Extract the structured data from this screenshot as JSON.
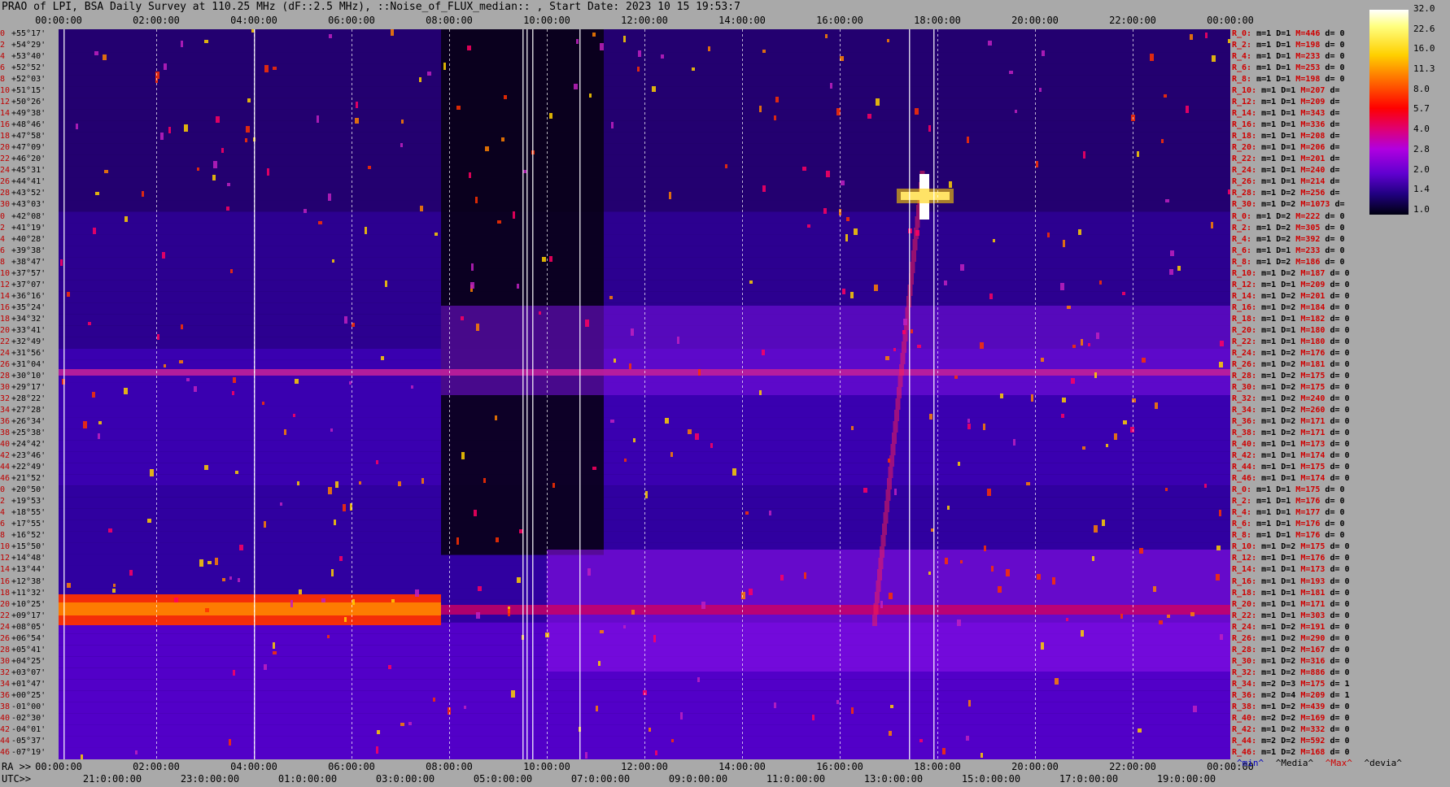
{
  "title": "PRAO of LPI, BSA Daily Survey at 110.25 MHz (dF::2.5 MHz), ::Noise_of_FLUX_median:: , Start Date: 2023 10 15 19:53:7",
  "top_time_labels": [
    "00:00:00",
    "02:00:00",
    "04:00:00",
    "06:00:00",
    "08:00:00",
    "10:00:00",
    "12:00:00",
    "14:00:00",
    "16:00:00",
    "18:00:00",
    "20:00:00",
    "22:00:00",
    "00:00:00"
  ],
  "bottom_ra_prefix": "RA >>",
  "bottom_ra_labels": [
    "00:00:00",
    "02:00:00",
    "04:00:00",
    "06:00:00",
    "08:00:00",
    "10:00:00",
    "12:00:00",
    "14:00:00",
    "16:00:00",
    "18:00:00",
    "20:00:00",
    "22:00:00",
    "00:00:00"
  ],
  "bottom_utc_prefix": "UTC>>",
  "bottom_utc_labels": [
    "21:0:00:00",
    "23:0:00:00",
    "01:0:00:00",
    "03:0:00:00",
    "05:0:00:00",
    "07:0:00:00",
    "09:0:00:00",
    "11:0:00:00",
    "13:0:00:00",
    "15:0:00:00",
    "17:0:00:00",
    "19:0:00:00"
  ],
  "colorbar_labels": [
    "32.0",
    "22.6",
    "16.0",
    "11.3",
    "8.0",
    "5.7",
    "4.0",
    "2.8",
    "2.0",
    "1.4",
    "1.0"
  ],
  "legend": {
    "min": "^min^",
    "median": "^Media^",
    "max": "^Max^",
    "devia": "^devia^"
  },
  "colors": {
    "background": "#a9a9a9",
    "index_red": "#c00000",
    "max_red": "#d00000",
    "plot_base": "#1a0050"
  },
  "row_labels": [
    {
      "i": "0",
      "d": "+55°17'"
    },
    {
      "i": "2",
      "d": "+54°29'"
    },
    {
      "i": "4",
      "d": "+53°40'"
    },
    {
      "i": "6",
      "d": "+52°52'"
    },
    {
      "i": "8",
      "d": "+52°03'"
    },
    {
      "i": "10",
      "d": "+51°15'"
    },
    {
      "i": "12",
      "d": "+50°26'"
    },
    {
      "i": "14",
      "d": "+49°38'"
    },
    {
      "i": "16",
      "d": "+48°46'"
    },
    {
      "i": "18",
      "d": "+47°58'"
    },
    {
      "i": "20",
      "d": "+47°09'"
    },
    {
      "i": "22",
      "d": "+46°20'"
    },
    {
      "i": "24",
      "d": "+45°31'"
    },
    {
      "i": "26",
      "d": "+44°41'"
    },
    {
      "i": "28",
      "d": "+43°52'"
    },
    {
      "i": "30",
      "d": "+43°03'"
    },
    {
      "i": "0",
      "d": "+42°08'"
    },
    {
      "i": "2",
      "d": "+41°19'"
    },
    {
      "i": "4",
      "d": "+40°28'"
    },
    {
      "i": "6",
      "d": "+39°38'"
    },
    {
      "i": "8",
      "d": "+38°47'"
    },
    {
      "i": "10",
      "d": "+37°57'"
    },
    {
      "i": "12",
      "d": "+37°07'"
    },
    {
      "i": "14",
      "d": "+36°16'"
    },
    {
      "i": "16",
      "d": "+35°24'"
    },
    {
      "i": "18",
      "d": "+34°32'"
    },
    {
      "i": "20",
      "d": "+33°41'"
    },
    {
      "i": "22",
      "d": "+32°49'"
    },
    {
      "i": "24",
      "d": "+31°56'"
    },
    {
      "i": "26",
      "d": "+31°04'"
    },
    {
      "i": "28",
      "d": "+30°10'"
    },
    {
      "i": "30",
      "d": "+29°17'"
    },
    {
      "i": "32",
      "d": "+28°22'"
    },
    {
      "i": "34",
      "d": "+27°28'"
    },
    {
      "i": "36",
      "d": "+26°34'"
    },
    {
      "i": "38",
      "d": "+25°38'"
    },
    {
      "i": "40",
      "d": "+24°42'"
    },
    {
      "i": "42",
      "d": "+23°46'"
    },
    {
      "i": "44",
      "d": "+22°49'"
    },
    {
      "i": "46",
      "d": "+21°52'"
    },
    {
      "i": "0",
      "d": "+20°50'"
    },
    {
      "i": "2",
      "d": "+19°53'"
    },
    {
      "i": "4",
      "d": "+18°55'"
    },
    {
      "i": "6",
      "d": "+17°55'"
    },
    {
      "i": "8",
      "d": "+16°52'"
    },
    {
      "i": "10",
      "d": "+15°50'"
    },
    {
      "i": "12",
      "d": "+14°48'"
    },
    {
      "i": "14",
      "d": "+13°44'"
    },
    {
      "i": "16",
      "d": "+12°38'"
    },
    {
      "i": "18",
      "d": "+11°32'"
    },
    {
      "i": "20",
      "d": "+10°25'"
    },
    {
      "i": "22",
      "d": "+09°17'"
    },
    {
      "i": "24",
      "d": "+08°05'"
    },
    {
      "i": "26",
      "d": "+06°54'"
    },
    {
      "i": "28",
      "d": "+05°41'"
    },
    {
      "i": "30",
      "d": "+04°25'"
    },
    {
      "i": "32",
      "d": "+03°07'"
    },
    {
      "i": "34",
      "d": "+01°47'"
    },
    {
      "i": "36",
      "d": "+00°25'"
    },
    {
      "i": "38",
      "d": "-01°00'"
    },
    {
      "i": "40",
      "d": "-02°30'"
    },
    {
      "i": "42",
      "d": "-04°01'"
    },
    {
      "i": "44",
      "d": "-05°37'"
    },
    {
      "i": "46",
      "d": "-07°19'"
    }
  ],
  "right_rows": [
    {
      "r": "R_0:",
      "m": "m=1",
      "D": "D=1",
      "M": "M=446",
      "d": "d= 0"
    },
    {
      "r": "R_2:",
      "m": "m=1",
      "D": "D=1",
      "M": "M=198",
      "d": "d= 0"
    },
    {
      "r": "R_4:",
      "m": "m=1",
      "D": "D=1",
      "M": "M=233",
      "d": "d= 0"
    },
    {
      "r": "R_6:",
      "m": "m=1",
      "D": "D=1",
      "M": "M=253",
      "d": "d= 0"
    },
    {
      "r": "R_8:",
      "m": "m=1",
      "D": "D=1",
      "M": "M=198",
      "d": "d= 0"
    },
    {
      "r": "R_10:",
      "m": "m=1",
      "D": "D=1",
      "M": "M=207",
      "d": "d="
    },
    {
      "r": "R_12:",
      "m": "m=1",
      "D": "D=1",
      "M": "M=209",
      "d": "d="
    },
    {
      "r": "R_14:",
      "m": "m=1",
      "D": "D=1",
      "M": "M=343",
      "d": "d="
    },
    {
      "r": "R_16:",
      "m": "m=1",
      "D": "D=1",
      "M": "M=336",
      "d": "d="
    },
    {
      "r": "R_18:",
      "m": "m=1",
      "D": "D=1",
      "M": "M=208",
      "d": "d="
    },
    {
      "r": "R_20:",
      "m": "m=1",
      "D": "D=1",
      "M": "M=206",
      "d": "d="
    },
    {
      "r": "R_22:",
      "m": "m=1",
      "D": "D=1",
      "M": "M=201",
      "d": "d="
    },
    {
      "r": "R_24:",
      "m": "m=1",
      "D": "D=1",
      "M": "M=240",
      "d": "d="
    },
    {
      "r": "R_26:",
      "m": "m=1",
      "D": "D=1",
      "M": "M=214",
      "d": "d="
    },
    {
      "r": "R_28:",
      "m": "m=1",
      "D": "D=2",
      "M": "M=256",
      "d": "d="
    },
    {
      "r": "R_30:",
      "m": "m=1",
      "D": "D=2",
      "M": "M=1073",
      "d": "d="
    },
    {
      "r": "R_0:",
      "m": "m=1",
      "D": "D=2",
      "M": "M=222",
      "d": "d= 0"
    },
    {
      "r": "R_2:",
      "m": "m=1",
      "D": "D=2",
      "M": "M=305",
      "d": "d= 0"
    },
    {
      "r": "R_4:",
      "m": "m=1",
      "D": "D=2",
      "M": "M=392",
      "d": "d= 0"
    },
    {
      "r": "R_6:",
      "m": "m=1",
      "D": "D=1",
      "M": "M=233",
      "d": "d= 0"
    },
    {
      "r": "R_8:",
      "m": "m=1",
      "D": "D=2",
      "M": "M=186",
      "d": "d= 0"
    },
    {
      "r": "R_10:",
      "m": "m=1",
      "D": "D=2",
      "M": "M=187",
      "d": "d= 0"
    },
    {
      "r": "R_12:",
      "m": "m=1",
      "D": "D=1",
      "M": "M=209",
      "d": "d= 0"
    },
    {
      "r": "R_14:",
      "m": "m=1",
      "D": "D=2",
      "M": "M=201",
      "d": "d= 0"
    },
    {
      "r": "R_16:",
      "m": "m=1",
      "D": "D=2",
      "M": "M=184",
      "d": "d= 0"
    },
    {
      "r": "R_18:",
      "m": "m=1",
      "D": "D=1",
      "M": "M=182",
      "d": "d= 0"
    },
    {
      "r": "R_20:",
      "m": "m=1",
      "D": "D=1",
      "M": "M=180",
      "d": "d= 0"
    },
    {
      "r": "R_22:",
      "m": "m=1",
      "D": "D=1",
      "M": "M=180",
      "d": "d= 0"
    },
    {
      "r": "R_24:",
      "m": "m=1",
      "D": "D=2",
      "M": "M=176",
      "d": "d= 0"
    },
    {
      "r": "R_26:",
      "m": "m=1",
      "D": "D=2",
      "M": "M=181",
      "d": "d= 0"
    },
    {
      "r": "R_28:",
      "m": "m=1",
      "D": "D=2",
      "M": "M=175",
      "d": "d= 0"
    },
    {
      "r": "R_30:",
      "m": "m=1",
      "D": "D=2",
      "M": "M=175",
      "d": "d= 0"
    },
    {
      "r": "R_32:",
      "m": "m=1",
      "D": "D=2",
      "M": "M=240",
      "d": "d= 0"
    },
    {
      "r": "R_34:",
      "m": "m=1",
      "D": "D=2",
      "M": "M=260",
      "d": "d= 0"
    },
    {
      "r": "R_36:",
      "m": "m=1",
      "D": "D=2",
      "M": "M=171",
      "d": "d= 0"
    },
    {
      "r": "R_38:",
      "m": "m=1",
      "D": "D=2",
      "M": "M=171",
      "d": "d= 0"
    },
    {
      "r": "R_40:",
      "m": "m=1",
      "D": "D=1",
      "M": "M=173",
      "d": "d= 0"
    },
    {
      "r": "R_42:",
      "m": "m=1",
      "D": "D=1",
      "M": "M=174",
      "d": "d= 0"
    },
    {
      "r": "R_44:",
      "m": "m=1",
      "D": "D=1",
      "M": "M=175",
      "d": "d= 0"
    },
    {
      "r": "R_46:",
      "m": "m=1",
      "D": "D=1",
      "M": "M=174",
      "d": "d= 0"
    },
    {
      "r": "R_0:",
      "m": "m=1",
      "D": "D=1",
      "M": "M=175",
      "d": "d= 0"
    },
    {
      "r": "R_2:",
      "m": "m=1",
      "D": "D=1",
      "M": "M=176",
      "d": "d= 0"
    },
    {
      "r": "R_4:",
      "m": "m=1",
      "D": "D=1",
      "M": "M=177",
      "d": "d= 0"
    },
    {
      "r": "R_6:",
      "m": "m=1",
      "D": "D=1",
      "M": "M=176",
      "d": "d= 0"
    },
    {
      "r": "R_8:",
      "m": "m=1",
      "D": "D=1",
      "M": "M=176",
      "d": "d= 0"
    },
    {
      "r": "R_10:",
      "m": "m=1",
      "D": "D=2",
      "M": "M=175",
      "d": "d= 0"
    },
    {
      "r": "R_12:",
      "m": "m=1",
      "D": "D=1",
      "M": "M=176",
      "d": "d= 0"
    },
    {
      "r": "R_14:",
      "m": "m=1",
      "D": "D=1",
      "M": "M=173",
      "d": "d= 0"
    },
    {
      "r": "R_16:",
      "m": "m=1",
      "D": "D=1",
      "M": "M=193",
      "d": "d= 0"
    },
    {
      "r": "R_18:",
      "m": "m=1",
      "D": "D=1",
      "M": "M=181",
      "d": "d= 0"
    },
    {
      "r": "R_20:",
      "m": "m=1",
      "D": "D=1",
      "M": "M=171",
      "d": "d= 0"
    },
    {
      "r": "R_22:",
      "m": "m=1",
      "D": "D=1",
      "M": "M=303",
      "d": "d= 0"
    },
    {
      "r": "R_24:",
      "m": "m=1",
      "D": "D=2",
      "M": "M=191",
      "d": "d= 0"
    },
    {
      "r": "R_26:",
      "m": "m=1",
      "D": "D=2",
      "M": "M=290",
      "d": "d= 0"
    },
    {
      "r": "R_28:",
      "m": "m=1",
      "D": "D=2",
      "M": "M=167",
      "d": "d= 0"
    },
    {
      "r": "R_30:",
      "m": "m=1",
      "D": "D=2",
      "M": "M=316",
      "d": "d= 0"
    },
    {
      "r": "R_32:",
      "m": "m=1",
      "D": "D=2",
      "M": "M=886",
      "d": "d= 0"
    },
    {
      "r": "R_34:",
      "m": "m=2",
      "D": "D=3",
      "M": "M=175",
      "d": "d= 1"
    },
    {
      "r": "R_36:",
      "m": "m=2",
      "D": "D=4",
      "M": "M=209",
      "d": "d= 1"
    },
    {
      "r": "R_38:",
      "m": "m=1",
      "D": "D=2",
      "M": "M=439",
      "d": "d= 0"
    },
    {
      "r": "R_40:",
      "m": "m=2",
      "D": "D=2",
      "M": "M=169",
      "d": "d= 0"
    },
    {
      "r": "R_42:",
      "m": "m=1",
      "D": "D=2",
      "M": "M=332",
      "d": "d= 0"
    },
    {
      "r": "R_44:",
      "m": "m=2",
      "D": "D=2",
      "M": "M=592",
      "d": "d= 0"
    },
    {
      "r": "R_46:",
      "m": "m=1",
      "D": "D=2",
      "M": "M=168",
      "d": "d= 0"
    }
  ]
}
